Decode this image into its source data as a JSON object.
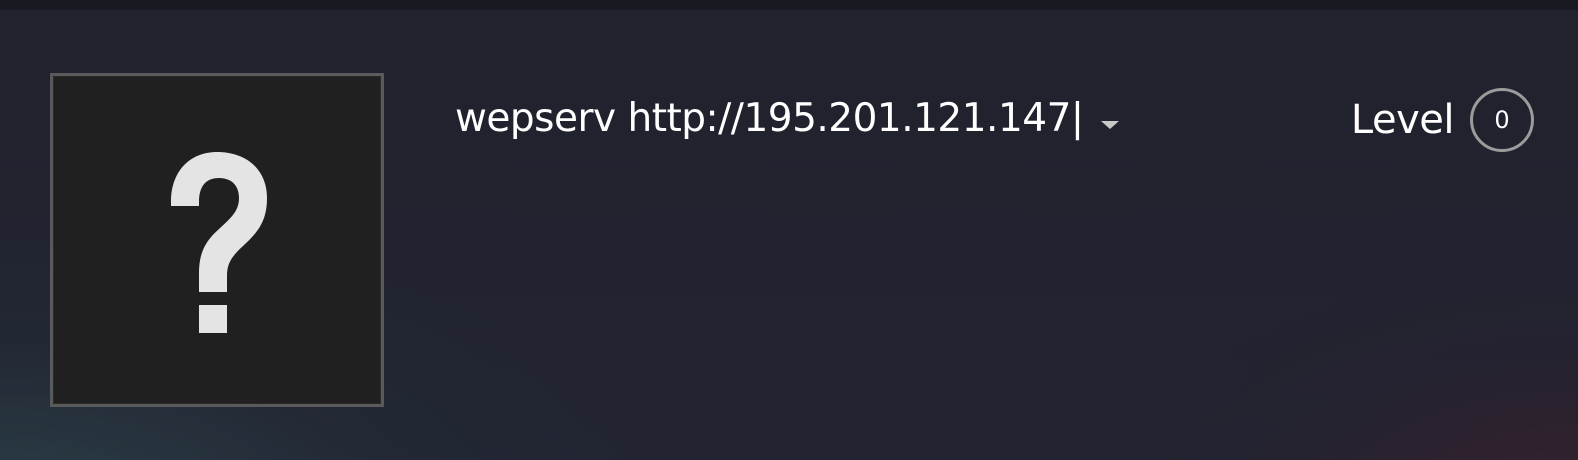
{
  "profile": {
    "persona_name": "wepserv http://195.201.121.147|",
    "avatar_icon": "question-mark-icon",
    "dropdown_icon": "caret-down-icon"
  },
  "level": {
    "label": "Level",
    "value": "0"
  },
  "colors": {
    "background": "#20222d",
    "top_strip": "#171a21",
    "avatar_border": "#5a5a5a",
    "avatar_fill": "#202020",
    "question_mark": "#e4e4e4",
    "level_ring": "#9b9b9b",
    "text": "#ffffff"
  }
}
